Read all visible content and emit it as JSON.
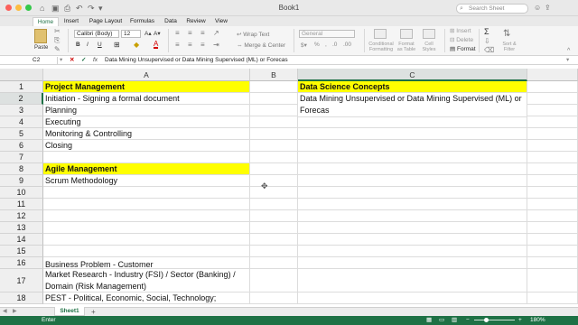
{
  "window": {
    "title": "Book1",
    "search_placeholder": "Search Sheet"
  },
  "tabs": [
    "Home",
    "Insert",
    "Page Layout",
    "Formulas",
    "Data",
    "Review",
    "View"
  ],
  "ribbon": {
    "paste_label": "Paste",
    "font_name": "Calibri (Body)",
    "font_size": "12",
    "bold": "B",
    "italic": "I",
    "underline": "U",
    "wrap_text_label": "Wrap Text",
    "merge_center_label": "Merge & Center",
    "number_format": "General",
    "conditional_formatting_label": "Conditional Formatting",
    "format_as_table_label": "Format as Table",
    "cell_styles_label": "Cell Styles",
    "insert_label": "Insert",
    "delete_label": "Delete",
    "format_label": "Format",
    "sort_filter_label": "Sort & Filter"
  },
  "formula_bar": {
    "name_box": "C2",
    "fx": "fx",
    "content": "Data Mining Unsupervised or Data Mining Supervised (ML) or Forecas"
  },
  "columns": [
    "A",
    "B",
    "C"
  ],
  "rows": [
    "1",
    "2",
    "3",
    "4",
    "5",
    "6",
    "7",
    "8",
    "9",
    "10",
    "11",
    "12",
    "13",
    "14",
    "15",
    "16",
    "17",
    "18"
  ],
  "cells": {
    "A1": "Project Management",
    "C1": "Data Science Concepts",
    "A2": "Initiation - Signing a formal document",
    "C2": "Data Mining Unsupervised or Data Mining Supervised (ML) or Forecas",
    "A3": "Planning",
    "A4": "Executing",
    "A5": "Monitoring & Controlling",
    "A6": "Closing",
    "A8": "Agile Management",
    "A9": "Scrum Methodology",
    "A16": "Business Problem - Customer",
    "A17": "Market Research - Industry (FSI) / Sector (Banking) / Domain (Risk Management)",
    "A18": "PEST - Political, Economic, Social, Technology;"
  },
  "sheet_tabs": [
    "Sheet1"
  ],
  "status": {
    "mode": "Enter",
    "zoom": "180%"
  },
  "colors": {
    "accent": "#1e7145",
    "highlight": "#ffff00"
  }
}
